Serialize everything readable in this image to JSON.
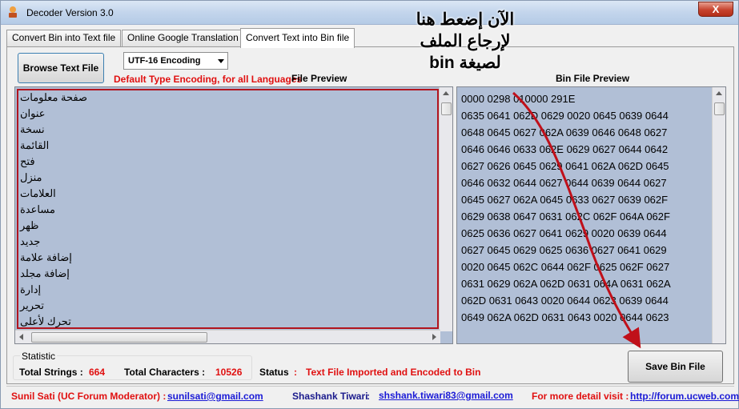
{
  "window": {
    "title": "Decoder Version 3.0",
    "close_label": "X"
  },
  "tabs": [
    {
      "label": "Convert Bin into Text file",
      "active": false
    },
    {
      "label": "Online Google Translation",
      "active": false
    },
    {
      "label": "Convert Text into Bin file",
      "active": true
    }
  ],
  "toolbar": {
    "browse_label": "Browse Text File",
    "encoding_selected": "UTF-16 Encoding",
    "encoding_note": "Default Type Encoding, for all Languages"
  },
  "text_preview": {
    "label": "File Preview",
    "lines": [
      "صفحة معلومات",
      "عنوان",
      "نسخة",
      "القائمة",
      "فتح",
      "منزل",
      "العلامات",
      "مساعدة",
      "ظهر",
      "جديد",
      "إضافة علامة",
      "إضافة مجلد",
      "إدارة",
      "تحرير",
      "تحرك لأعلى"
    ]
  },
  "bin_preview": {
    "label": "Bin File Preview",
    "lines": [
      "0000 0298 010000 291E",
      "0635 0641 062D 0629 0020 0645 0639 0644",
      "0648 0645 0627 062A 0639 0646 0648 0627",
      "0646 0646 0633 062E 0629 0627 0644 0642",
      "0627 0626 0645 0629 0641 062A 062D 0645",
      "0646 0632 0644 0627 0644 0639 0644 0627",
      "0645 0627 062A 0645 0633 0627 0639 062F",
      "0629 0638 0647 0631 062C 062F 064A 062F",
      "0625 0636 0627 0641 0629 0020 0639 0644",
      "0627 0645 0629 0625 0636 0627 0641 0629",
      "0020 0645 062C 0644 062F 0625 062F 0627",
      "0631 0629 062A 062D 0631 064A 0631 062A",
      "062D 0631 0643 0020 0644 0623 0639 0644",
      "0649 062A 062D 0631 0643 0020 0644 0623"
    ]
  },
  "overlay_annotation": {
    "lines": [
      "الآن إضعط هنا",
      "لإرجاع الملف",
      "لصيغة bin"
    ],
    "arrow_color": "#c0101a"
  },
  "statistic": {
    "legend": "Statistic",
    "total_strings_label": "Total Strings :",
    "total_strings_value": "664",
    "total_chars_label": "Total Characters :",
    "total_chars_value": "10526"
  },
  "status": {
    "label": "Status",
    "separator": ":",
    "text": "Text File Imported and Encoded to Bin"
  },
  "save_label": "Save Bin File",
  "footer": {
    "author1": "Sunil Sati (UC Forum Moderator) :",
    "author1_email": "sunilsati@gmail.com",
    "author2": "Shashank Tiwari",
    "author2_sep": ":",
    "author2_email": "shshank.tiwari83@gmail.com",
    "more_label": "For more detail visit :",
    "more_url": "http://forum.ucweb.com"
  },
  "colors": {
    "accent_red": "#e01010",
    "preview_bg": "#b1bfd6",
    "link_blue": "#1a1ad6"
  }
}
